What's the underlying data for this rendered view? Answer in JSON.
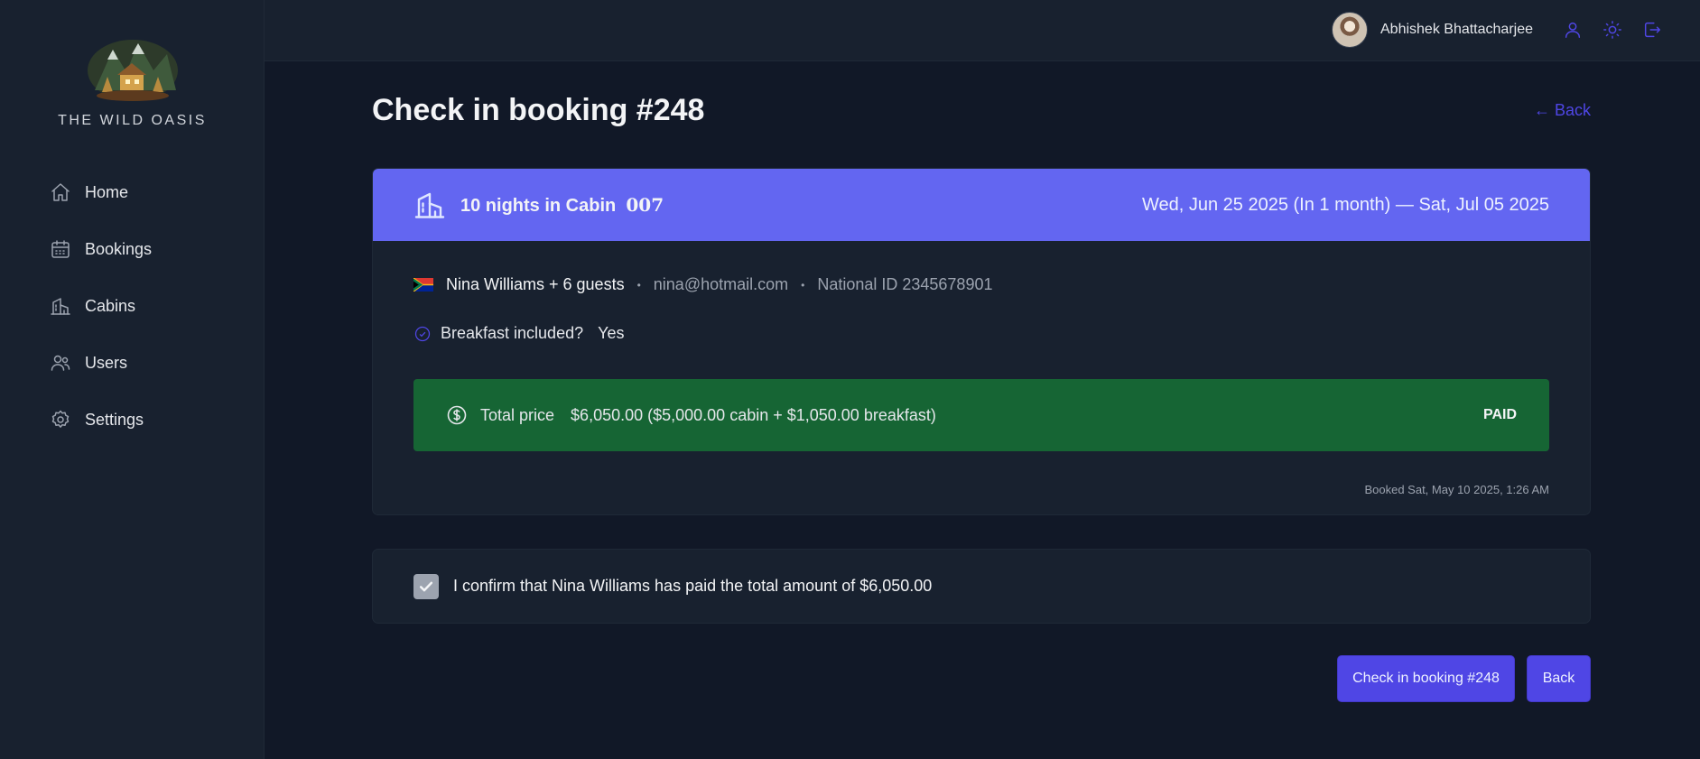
{
  "app": {
    "logo_text": "THE WILD OASIS"
  },
  "sidebar": {
    "items": [
      {
        "label": "Home",
        "icon": "home-icon"
      },
      {
        "label": "Bookings",
        "icon": "calendar-icon"
      },
      {
        "label": "Cabins",
        "icon": "cabin-icon"
      },
      {
        "label": "Users",
        "icon": "users-icon"
      },
      {
        "label": "Settings",
        "icon": "gear-icon"
      }
    ]
  },
  "header": {
    "user_name": "Abhishek Bhattacharjee",
    "icons": [
      "user-icon",
      "sun-icon",
      "logout-icon"
    ]
  },
  "page": {
    "title": "Check in booking #248",
    "back_link": "← Back"
  },
  "booking": {
    "nights_text": "10 nights in Cabin",
    "cabin_name": "007",
    "dates": "Wed, Jun 25 2025 (In 1 month) — Sat, Jul 05 2025",
    "guest": "Nina Williams + 6 guests",
    "email": "nina@hotmail.com",
    "national_id": "National ID 2345678901",
    "breakfast_label": "Breakfast included?",
    "breakfast_value": "Yes",
    "price_label": "Total price",
    "price_value": "$6,050.00 ($5,000.00 cabin + $1,050.00 breakfast)",
    "status": "PAID",
    "booked_at": "Booked Sat, May 10 2025, 1:26 AM",
    "accent_color": "#6366f1",
    "paid_color": "#166534"
  },
  "confirm": {
    "text": "I confirm that Nina Williams has paid the total amount of $6,050.00",
    "checked": true
  },
  "actions": {
    "checkin_label": "Check in booking #248",
    "back_label": "Back"
  }
}
